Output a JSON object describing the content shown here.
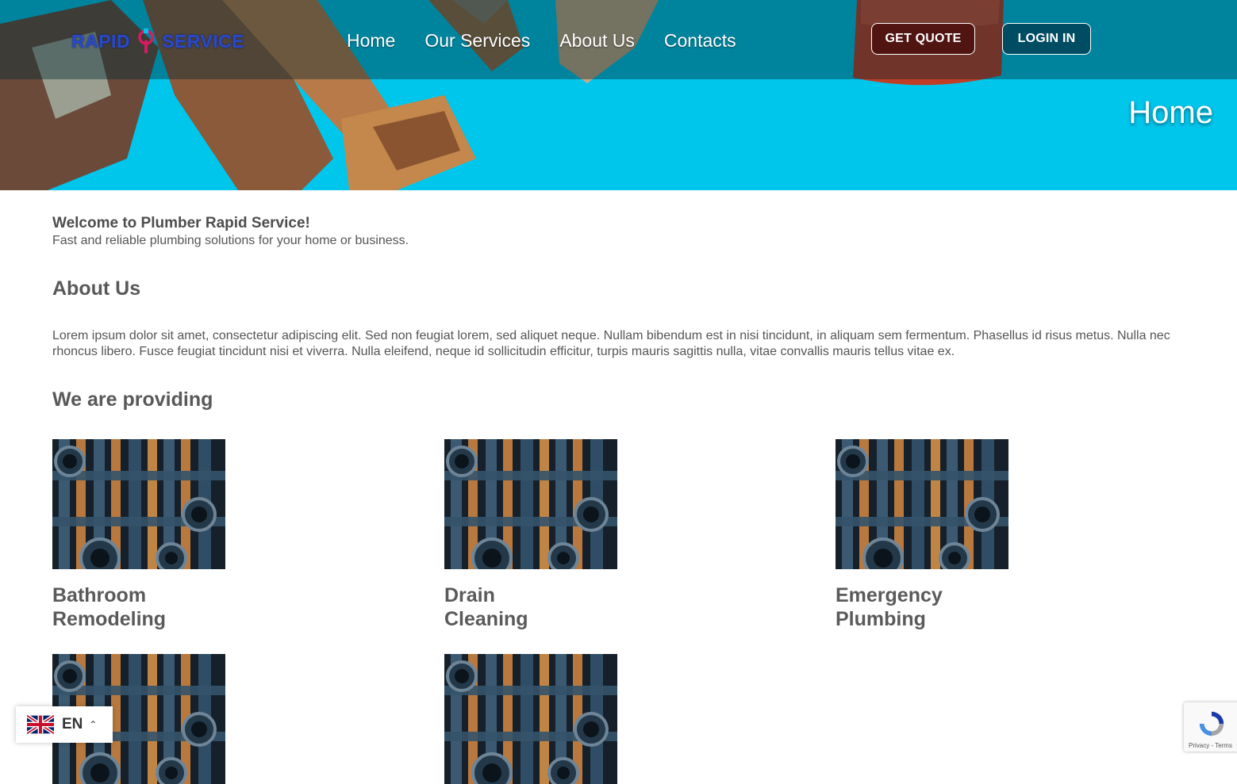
{
  "header": {
    "logo_left": "RAPID",
    "logo_right": "SERVICE",
    "nav": [
      "Home",
      "Our Services",
      "About Us",
      "Contacts"
    ],
    "quote_label": "GET QUOTE",
    "login_label": "LOGIN IN",
    "hero_title": "Home"
  },
  "welcome": {
    "title": "Welcome to Plumber Rapid Service!",
    "subtitle": "Fast and reliable plumbing solutions for your home or business."
  },
  "about": {
    "title": "About Us",
    "text": "Lorem ipsum dolor sit amet, consectetur adipiscing elit. Sed non feugiat lorem, sed aliquet neque. Nullam bibendum est in nisi tincidunt, in aliquam sem fermentum. Phasellus id risus metus. Nulla nec rhoncus libero. Fusce feugiat tincidunt nisi et viverra. Nulla eleifend, neque id sollicitudin efficitur, turpis mauris sagittis nulla, vitae convallis mauris tellus vitae ex."
  },
  "services": {
    "title": "We are providing",
    "items": [
      {
        "name": "Bathroom Remodeling"
      },
      {
        "name": "Drain Cleaning"
      },
      {
        "name": "Emergency Plumbing"
      },
      {
        "name": ""
      },
      {
        "name": ""
      }
    ]
  },
  "language": {
    "code": "EN"
  },
  "recaptcha": {
    "terms": "Privacy - Terms"
  },
  "colors": {
    "hero_bg": "#00c8ef",
    "heading": "#595959",
    "logo": "#2a49c9",
    "logo_mark": "#d81b60"
  }
}
